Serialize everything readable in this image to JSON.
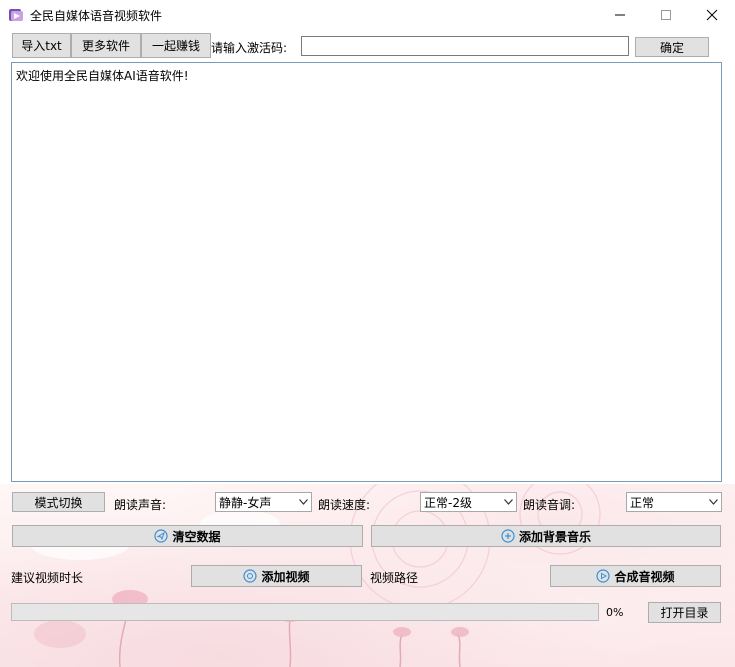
{
  "window": {
    "title": "全民自媒体语音视频软件"
  },
  "toolbar": {
    "import_txt": "导入txt",
    "more_software": "更多软件",
    "earn_together": "一起赚钱",
    "activation_label": "请输入激活码:",
    "activation_value": "",
    "confirm": "确定"
  },
  "editor": {
    "text": "欢迎使用全民自媒体AI语音软件!"
  },
  "controls": {
    "mode_switch": "模式切换",
    "voice_label": "朗读声音:",
    "voice_value": "静静-女声",
    "speed_label": "朗读速度:",
    "speed_value": "正常-2级",
    "pitch_label": "朗读音调:",
    "pitch_value": "正常",
    "clear_data": "清空数据",
    "add_bgm": "添加背景音乐",
    "suggest_duration": "建议视频时长",
    "add_video": "添加视频",
    "video_path": "视频路径",
    "compose": "合成音视频",
    "progress_percent": 0,
    "progress_text": "0%",
    "open_dir": "打开目录"
  },
  "colors": {
    "accent_icon": "#3a8fd6",
    "button_bg": "#e1e1e1",
    "editor_border": "#7a9bb6"
  }
}
